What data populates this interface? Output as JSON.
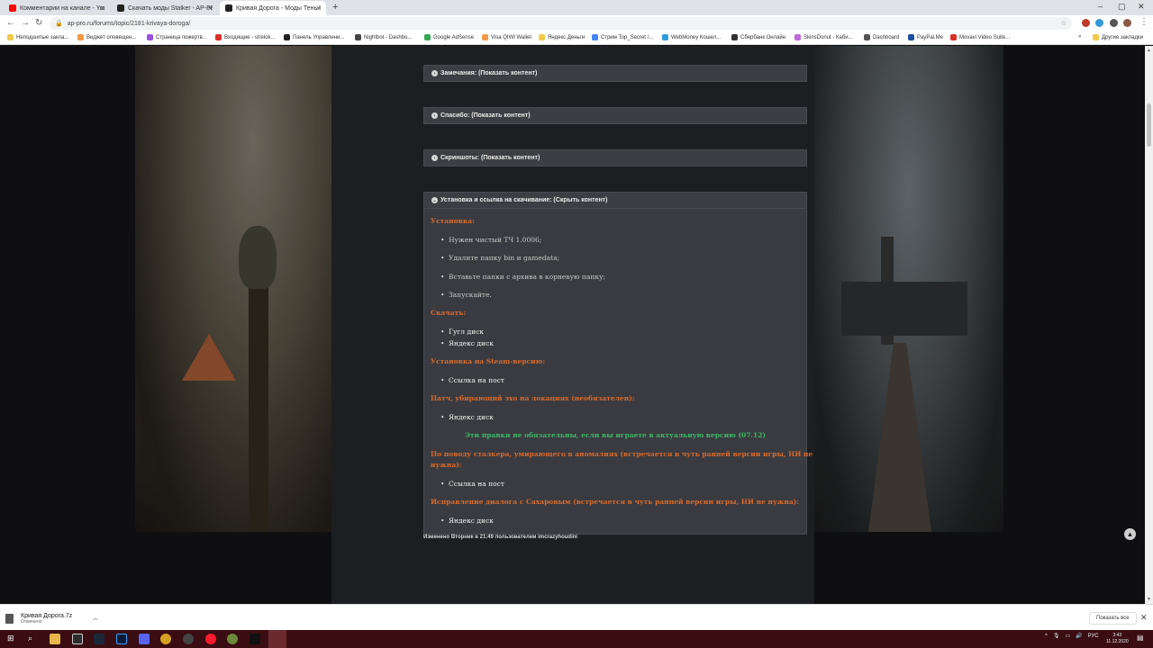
{
  "browser": {
    "tabs": [
      {
        "title": "Комментарии на канале - YouTu",
        "color": "#ff0000"
      },
      {
        "title": "Скачать моды Stalker - AP-PRO.",
        "color": "#222222"
      },
      {
        "title": "Кривая Дорога - Моды Тень Че",
        "color": "#222222"
      }
    ],
    "new_tab": "+",
    "close_glyph": "✕",
    "window_controls": [
      "–",
      "▢",
      "✕"
    ],
    "url": "ap-pro.ru/forums/topic/2181-krivaya-doroga/",
    "bookmarks": [
      {
        "label": "Неподшитые закла...",
        "color": "#f2c94c"
      },
      {
        "label": "Виджет оповещен...",
        "color": "#f2994a"
      },
      {
        "label": "Страница пожертв...",
        "color": "#9b51e0"
      },
      {
        "label": "Входящие - strelok...",
        "color": "#d93025"
      },
      {
        "label": "Панель Управлени...",
        "color": "#222222"
      },
      {
        "label": "Nightbot - Dashbo...",
        "color": "#444444"
      },
      {
        "label": "Google AdSense",
        "color": "#34a853"
      },
      {
        "label": "Visa QIWI Wallet",
        "color": "#f2994a"
      },
      {
        "label": "Яндекс Деньги",
        "color": "#f2c94c"
      },
      {
        "label": "Стрим Top_Secret /...",
        "color": "#4285f4"
      },
      {
        "label": "WebMoney Кошел...",
        "color": "#2d9cdb"
      },
      {
        "label": "Сбербанк Онлайн",
        "color": "#333333"
      },
      {
        "label": "SkinsDonut - Каби...",
        "color": "#bb6bd9"
      },
      {
        "label": "Dashboard",
        "color": "#555555"
      },
      {
        "label": "PayPal.Me",
        "color": "#1a4fa0"
      },
      {
        "label": "Movavi Video Suite...",
        "color": "#d93025"
      }
    ],
    "other_bookmarks": "Другие закладки"
  },
  "post": {
    "spoilers": [
      "Замечания: (Показать контент)",
      "Спасибо: (Показать контент)",
      "Скриншоты: (Показать контент)",
      "Установка и ссылка на скачивание: (Скрыть контент)"
    ],
    "install_title": "Установка:",
    "install_steps": [
      "Нужен чистый ТЧ 1.0006;",
      "Удалите папку bin и gamedata;",
      "Вставьте папки с архива в корневую папку;",
      "Запускайте."
    ],
    "download_title": "Скачать:",
    "download_links": [
      "Гугл диск",
      "Яндекс диск"
    ],
    "steam_title": "Установка на Steam-версию:",
    "steam_link": "Ссылка на пост",
    "patch_title": "Патч, убирающий эхо на локациях (необязателен):",
    "patch_link": "Яндекс диск",
    "note": "Эти правки не обязательны, если вы играете в актуальную версию (07.12)",
    "anomaly_title_1": "По поводу сталкера, умирающего в аномалиях (встречается в чуть ранней версии игры, НИ не",
    "anomaly_title_2": "нужна):",
    "anomaly_link": "Ссылка на пост",
    "dialog_title": "Исправление диалога с Сахаровым (встречается в чуть ранней версии игры, НИ не нужна):",
    "dialog_link": "Яндекс диск",
    "edited": "Изменено Вторник в 21:49 пользователем imcrazyhoudini"
  },
  "downloads": {
    "file_name": "Кривая Дорога.7z",
    "status": "Отменено",
    "show_all": "Показать все"
  },
  "taskbar": {
    "lang": "РУС",
    "time": "3:43",
    "date": "11.12.2020"
  },
  "colors": {
    "accent_orange": "#d76a2b",
    "note_green": "#3cb86a",
    "taskbar": "#3a0d12"
  }
}
